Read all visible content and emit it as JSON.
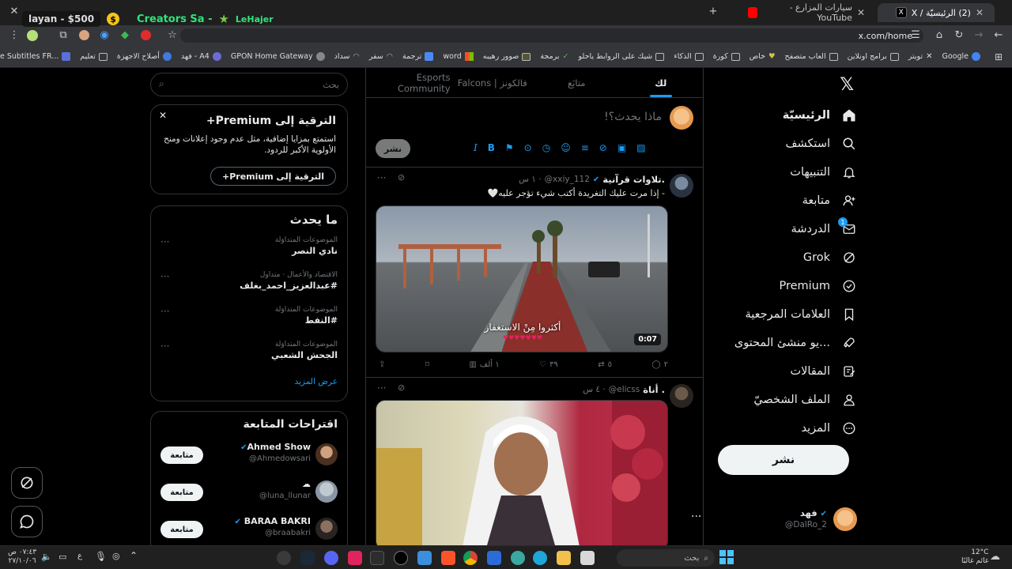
{
  "browser": {
    "tabs": [
      {
        "title": "(2) الرئيسيّة / X",
        "active": true
      },
      {
        "title": "سيارات المزارع - YouTube",
        "active": false
      }
    ],
    "url": "x.com/home",
    "overlay": {
      "left_pill": "layan - $500",
      "creators": "Creators Sa -",
      "lehajer": "LeHajer"
    },
    "bookmarks": [
      "Google",
      "تويتر",
      "برامج اونلاين",
      "العاب متصفح",
      "خاص",
      "كورة",
      "الذكاء",
      "شيك على الروابط ياحلو",
      "برمجة",
      "صوور رهيبه",
      "word",
      "ترجمة",
      "سفر",
      "سداد",
      "GPON Home Gateway",
      "فهد - A4",
      "أصلاح الاجهزة",
      "تعليم",
      "Translate Subtitles FR..."
    ]
  },
  "nav": {
    "items": [
      {
        "label": "الرئيسيّة",
        "icon": "home-icon"
      },
      {
        "label": "استكشف",
        "icon": "search-icon"
      },
      {
        "label": "التنبيهات",
        "icon": "bell-icon"
      },
      {
        "label": "متابعة",
        "icon": "follow-icon"
      },
      {
        "label": "الدردشة",
        "icon": "mail-icon"
      },
      {
        "label": "Grok",
        "icon": "grok-icon"
      },
      {
        "label": "Premium",
        "icon": "premium-icon"
      },
      {
        "label": "العلامات المرجعية",
        "icon": "bookmark-icon"
      },
      {
        "label": "...يو منشئ المحتوى",
        "icon": "rocket-icon"
      },
      {
        "label": "المقالات",
        "icon": "article-icon"
      },
      {
        "label": "الملف الشخصيّ",
        "icon": "profile-icon"
      },
      {
        "label": "المزيد",
        "icon": "more-icon"
      }
    ],
    "badge": "1",
    "post_button": "نشر",
    "account": {
      "name": "فهد",
      "handle": "@DalRo_2"
    }
  },
  "feed": {
    "tabs": [
      "لك",
      "متابَع",
      "فالكونز | Falcons",
      "Esports Community"
    ],
    "composer_placeholder": "ماذا يحدث؟!",
    "composer_button": "نشر",
    "posts": [
      {
        "name": ".تلاوات قرآنية",
        "handle": "@xxiy_112",
        "time": "· ١ س",
        "text": "- إذا مرت عليك التغريدة أكتب شيء تؤجر عليه🤍",
        "video_caption": "أكثروا مِنْ الاستغفار",
        "hearts": "♥♥♥♥♥♥♥",
        "duration": "0:07",
        "replies": "٢",
        "reposts": "٥",
        "likes": "٣٩",
        "views": "١ ألف"
      },
      {
        "name": ". أناة",
        "handle": "@elicss",
        "time": "· ٤ س"
      }
    ]
  },
  "sidebar": {
    "search_placeholder": "بحث",
    "premium": {
      "title": "الترقية إلى Premium+",
      "body": "استمتع بمزايا إضافية، مثل عدم وجود إعلانات ومنح الأولوية الأكبر للردود.",
      "button": "الترقية إلى Premium+"
    },
    "trends_title": "ما يحدث",
    "trends": [
      {
        "meta": "الموضوعات المتداوَلة",
        "name": "نادي النصر"
      },
      {
        "meta": "الاقتصاد والأعمال · متداول",
        "name": "#عبدالعزيز_احمد_بغلف"
      },
      {
        "meta": "الموضوعات المتداوَلة",
        "name": "#النفط"
      },
      {
        "meta": "الموضوعات المتداوَلة",
        "name": "الجحش الشعبي"
      }
    ],
    "show_more": "عرض المزيد",
    "follow_title": "اقتراحات المتابعة",
    "follow": [
      {
        "name": "Ahmed Show",
        "handle": "@Ahmedowsari",
        "button": "متابعة"
      },
      {
        "name": "☁",
        "handle": "@luna_llunar",
        "button": "متابعة"
      },
      {
        "name": "BARAA BAKRI",
        "handle": "@braabakri",
        "button": "متابعة"
      }
    ]
  },
  "taskbar": {
    "search": "بحث",
    "weather_temp": "12°C",
    "weather_text": "غائم غالبًا",
    "time": "٠٧:٤٣ ص",
    "date": "٢٧/١٠/٠٦",
    "lang": "ع"
  }
}
